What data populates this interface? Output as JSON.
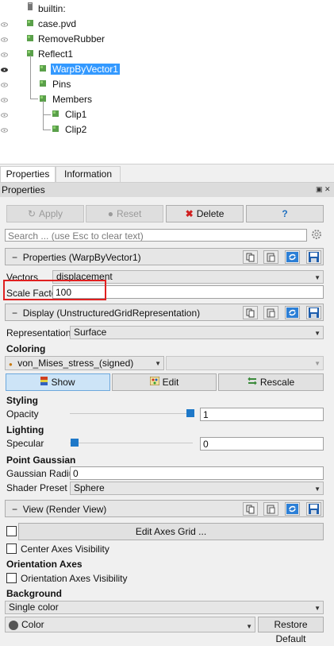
{
  "pipeline": {
    "items": [
      {
        "label": "builtin:"
      },
      {
        "label": "case.pvd"
      },
      {
        "label": "RemoveRubber"
      },
      {
        "label": "Reflect1"
      },
      {
        "label": "WarpByVector1"
      },
      {
        "label": "Pins"
      },
      {
        "label": "Members"
      },
      {
        "label": "Clip1"
      },
      {
        "label": "Clip2"
      }
    ]
  },
  "tabs": [
    {
      "label": "Properties"
    },
    {
      "label": "Information"
    }
  ],
  "panel": {
    "title": "Properties",
    "float_icon": "float-icon",
    "close_icon": "close-icon"
  },
  "toolbar": {
    "apply_label": "Apply",
    "reset_label": "Reset",
    "delete_label": "Delete",
    "help_label": "?"
  },
  "search": {
    "placeholder": "Search ... (use Esc to clear text)"
  },
  "properties_section": {
    "label": "Properties (WarpByVector1)",
    "vectors_label": "Vectors",
    "vectors_value": "displacement",
    "scale_factor_label": "Scale Factor",
    "scale_factor_value": "100"
  },
  "display_section": {
    "label": "Display (UnstructuredGridRepresentation)",
    "representation_label": "Representation",
    "representation_value": "Surface",
    "coloring_label": "Coloring",
    "coloring_value": "von_Mises_stress_(signed)",
    "show_label": "Show",
    "edit_label": "Edit",
    "rescale_label": "Rescale",
    "styling_label": "Styling",
    "opacity_label": "Opacity",
    "opacity_value": "1",
    "lighting_label": "Lighting",
    "specular_label": "Specular",
    "specular_value": "0",
    "point_gaussian_label": "Point Gaussian",
    "gaussian_radius_label": "Gaussian Radius",
    "gaussian_radius_value": "0",
    "shader_preset_label": "Shader Preset",
    "shader_preset_value": "Sphere"
  },
  "view_section": {
    "label": "View (Render View)",
    "edit_axes_grid_label": "Edit Axes Grid ...",
    "center_axes_label": "Center Axes Visibility",
    "orientation_axes_header": "Orientation Axes",
    "orientation_axes_label": "Orientation Axes Visibility",
    "background_label": "Background",
    "background_value": "Single color",
    "color_label": "Color",
    "restore_default_label": "Restore Default"
  },
  "colors": {
    "selection": "#3399ff",
    "highlight": "#e02020",
    "slider_handle": "#1e78c8",
    "node_green": "#4caf50"
  }
}
